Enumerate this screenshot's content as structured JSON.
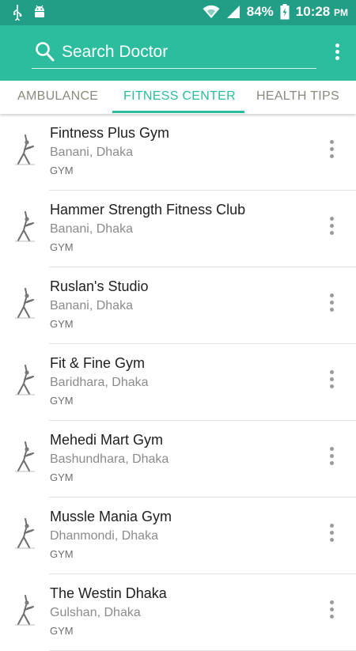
{
  "status_bar": {
    "battery": "84%",
    "time": "10:28",
    "ampm": "PM",
    "icons": [
      "usb-icon",
      "android-icon",
      "wifi-icon",
      "signal-icon",
      "battery-charging-icon"
    ]
  },
  "toolbar": {
    "search_placeholder": "Search Doctor",
    "accent_color": "#2bbd9d",
    "status_color": "#239e86"
  },
  "tabs": [
    {
      "label": "AMBULANCE",
      "active": false
    },
    {
      "label": "FITNESS CENTER",
      "active": true
    },
    {
      "label": "HEALTH TIPS",
      "active": false
    }
  ],
  "list": [
    {
      "name": "Fintness Plus Gym",
      "location": "Banani, Dhaka",
      "category": "GYM"
    },
    {
      "name": "Hammer Strength Fitness Club",
      "location": "Banani, Dhaka",
      "category": "GYM"
    },
    {
      "name": "Ruslan's Studio",
      "location": "Banani, Dhaka",
      "category": "GYM"
    },
    {
      "name": "Fit & Fine Gym",
      "location": "Baridhara, Dhaka",
      "category": "GYM"
    },
    {
      "name": "Mehedi Mart Gym",
      "location": "Bashundhara, Dhaka",
      "category": "GYM"
    },
    {
      "name": "Mussle Mania Gym",
      "location": "Dhanmondi, Dhaka",
      "category": "GYM"
    },
    {
      "name": "The Westin Dhaka",
      "location": "Gulshan, Dhaka",
      "category": "GYM"
    }
  ]
}
